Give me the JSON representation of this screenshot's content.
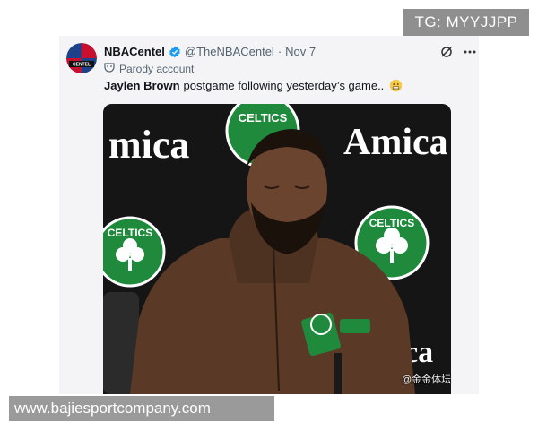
{
  "overlay": {
    "tg_label": "TG: MYYJJPP",
    "site_url": "www.bajiesportcompany.com"
  },
  "tweet": {
    "display_name": "NBACentel",
    "handle": "@TheNBACentel",
    "separator": "·",
    "date": "Nov 7",
    "parody_label": "Parody account",
    "text_name": "Jaylen Brown",
    "text_body": "postgame following yesterday’s game..",
    "avatar_text": "CENTEL",
    "verified": true
  },
  "photo": {
    "sponsor_word_left": "mica",
    "sponsor_word_right": "Amica",
    "sponsor_word_bottom": "ca",
    "team_logo_text": "CELTICS",
    "watermark": "@金金体坛"
  },
  "colors": {
    "celtics_green": "#1f8a3b",
    "verified_blue": "#1d9bf0",
    "jacket_brown": "#5a3a26"
  },
  "icons": [
    "grok-icon",
    "more-icon",
    "verified-badge-icon",
    "parody-mask-icon",
    "grimace-emoji-icon"
  ]
}
